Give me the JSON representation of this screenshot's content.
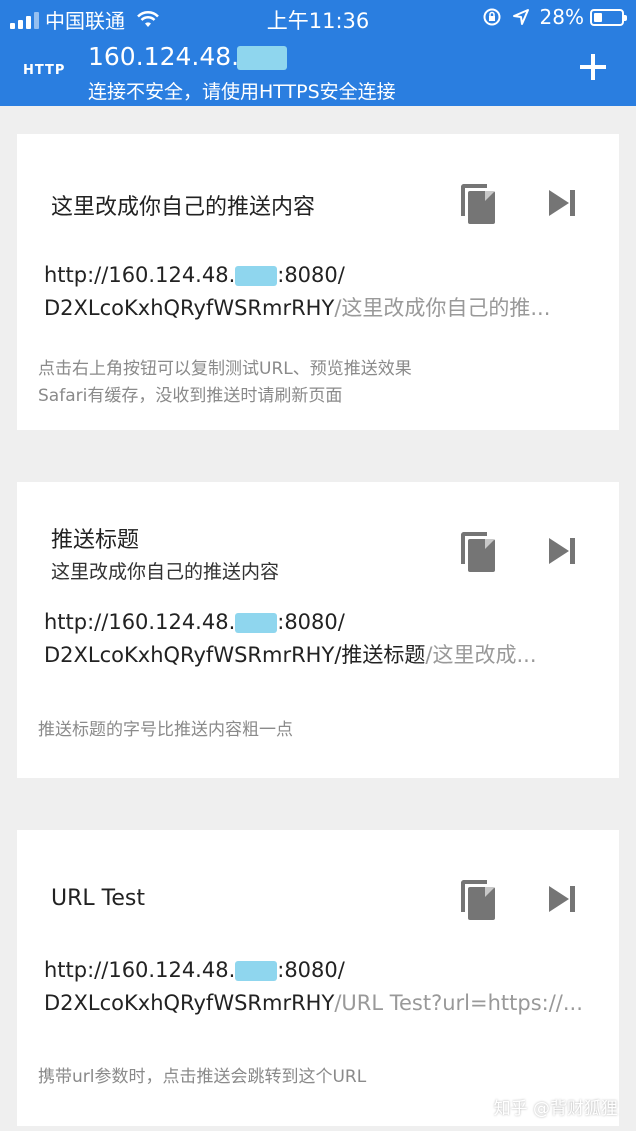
{
  "status_bar": {
    "carrier": "中国联通",
    "time": "上午11:36",
    "battery": "28%"
  },
  "header": {
    "protocol": "HTTP",
    "host": "160.124.48.",
    "warning": "连接不安全，请使用HTTPS安全连接"
  },
  "cards": [
    {
      "title": "这里改成你自己的推送内容",
      "subtitle": "",
      "url_prefix": "http://160.124.48.",
      "url_port": ":8080/",
      "url_key": "D2XLcoKxhQRyfWSRmrRHY",
      "url_rest": "/这里改成你自己的推...",
      "hint_1": "点击右上角按钮可以复制测试URL、预览推送效果",
      "hint_2": "Safari有缓存，没收到推送时请刷新页面"
    },
    {
      "title": "推送标题",
      "subtitle": "这里改成你自己的推送内容",
      "url_prefix": "http://160.124.48.",
      "url_port": ":8080/",
      "url_key": "D2XLcoKxhQRyfWSRmrRHY",
      "url_rest_dark": "/推送标题",
      "url_rest": "/这里改成...",
      "hint_1": "推送标题的字号比推送内容粗一点"
    },
    {
      "title": "URL Test",
      "url_prefix": "http://160.124.48.",
      "url_port": ":8080/",
      "url_key": "D2XLcoKxhQRyfWSRmrRHY",
      "url_rest": "/URL Test?url=https://...",
      "hint_1": "携带url参数时，点击推送会跳转到这个URL"
    }
  ],
  "watermark": "知乎 @背财狐狸",
  "colors": {
    "header_bg": "#2a7ee0",
    "page_bg": "#efefef",
    "icon": "#757575",
    "mask": "#8fd6ee"
  }
}
